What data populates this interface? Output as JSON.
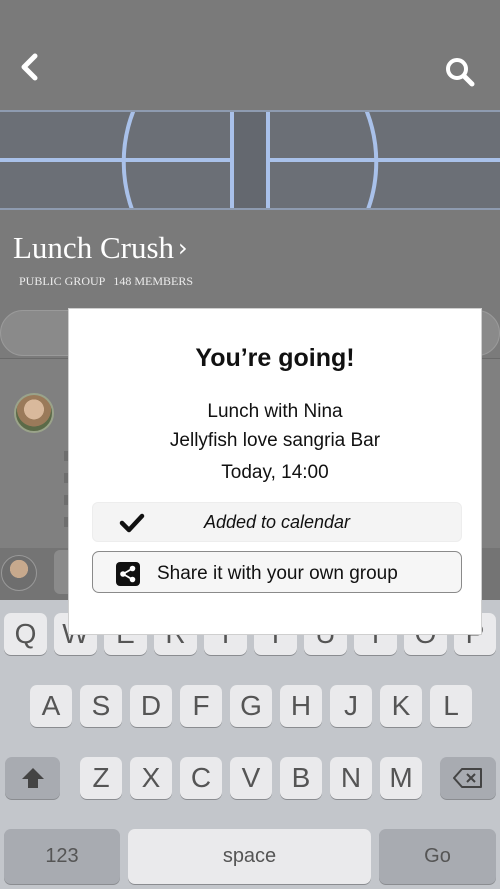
{
  "header": {
    "back_icon": "chevron-left-icon",
    "search_icon": "search-icon"
  },
  "group": {
    "title": "Lunch Crush",
    "chevron": "›",
    "visibility": "PUBLIC GROUP",
    "members": "148 MEMBERS"
  },
  "modal": {
    "title": "You’re going!",
    "event_name": "Lunch with Nina",
    "venue": "Jellyfish love sangria Bar",
    "time": "Today, 14:00",
    "calendar_icon": "checkmark-icon",
    "calendar_label": "Added to calendar",
    "share_icon": "share-icon",
    "share_label": "Share it with your own group"
  },
  "keyboard": {
    "row1": [
      "Q",
      "W",
      "E",
      "R",
      "T",
      "Y",
      "U",
      "I",
      "O",
      "P"
    ],
    "row2": [
      "A",
      "S",
      "D",
      "F",
      "G",
      "H",
      "J",
      "K",
      "L"
    ],
    "row3": [
      "Z",
      "X",
      "C",
      "V",
      "B",
      "N",
      "M"
    ],
    "numbers_label": "123",
    "space_label": "space",
    "go_label": "Go",
    "shift_icon": "shift-icon",
    "delete_icon": "backspace-icon"
  }
}
